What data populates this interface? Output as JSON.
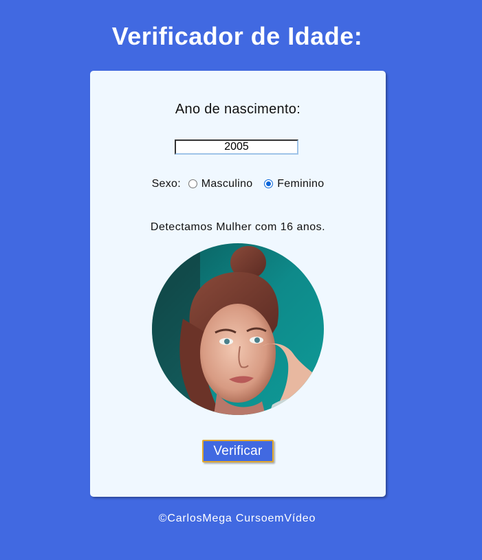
{
  "header": {
    "title": "Verificador de Idade:"
  },
  "form": {
    "birth_year_label": "Ano de nascimento:",
    "birth_year_value": "2005",
    "sex_label": "Sexo:",
    "sex_options": [
      {
        "label": "Masculino",
        "checked": false
      },
      {
        "label": "Feminino",
        "checked": true
      }
    ],
    "verify_button_label": "Verificar"
  },
  "result": {
    "text": "Detectamos Mulher com 16 anos.",
    "image_icon": "woman-photo"
  },
  "footer": {
    "text": "©CarlosMega CursoemVídeo"
  },
  "colors": {
    "background": "#4169e1",
    "card": "#f0f8ff",
    "button": "#4169e1",
    "button_border": "#e3a92e",
    "radio_checked": "#0a66d9"
  }
}
